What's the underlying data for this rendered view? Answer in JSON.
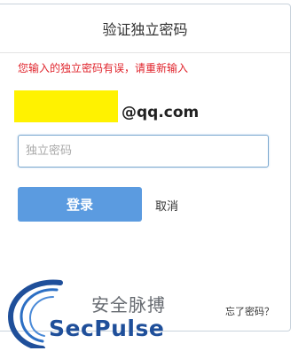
{
  "dialog": {
    "title": "验证独立密码",
    "error_message": "您输入的独立密码有误，请重新输入",
    "account_suffix": "@qq.com",
    "password_placeholder": "独立密码",
    "login_label": "登录",
    "cancel_label": "取消",
    "forgot_label": "忘了密码？"
  },
  "watermark": {
    "cn_text": "安全脉搏",
    "en_text": "SecPulse"
  },
  "colors": {
    "error": "#e0242c",
    "button": "#5b9be0",
    "redaction": "#fff200",
    "watermark_blue": "#1f4f9a"
  }
}
